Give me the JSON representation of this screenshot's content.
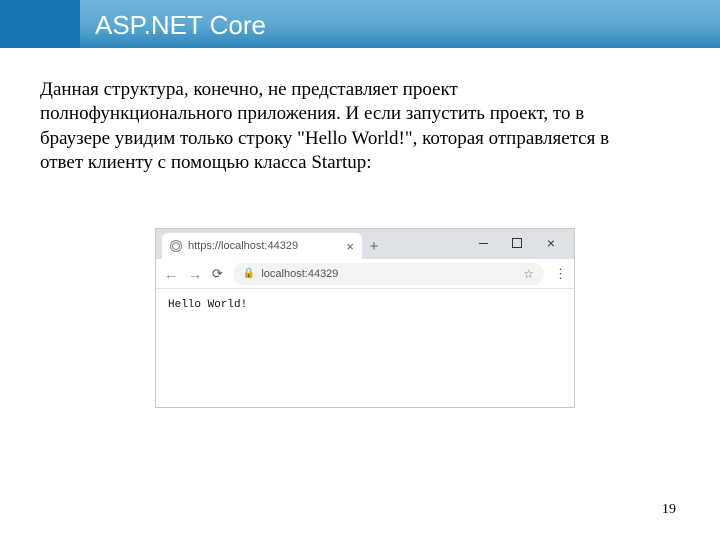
{
  "header": {
    "title": "ASP.NET Core"
  },
  "body": {
    "paragraph": "Данная структура, конечно, не представляет проект полнофункционального приложения. И если запустить проект, то в браузере увидим только строку \"Hello World!\", которая отправляется в ответ клиенту с помощью класса Startup:"
  },
  "browser": {
    "tab_title": "https://localhost:44329",
    "tab_close": "×",
    "new_tab": "+",
    "win_close": "×",
    "address": "localhost:44329",
    "page_text": "Hello World!",
    "menu_dots": "⋮",
    "star": "☆",
    "lock": "🔒",
    "reload": "⟳",
    "back": "←",
    "forward": "→"
  },
  "page_number": "19"
}
